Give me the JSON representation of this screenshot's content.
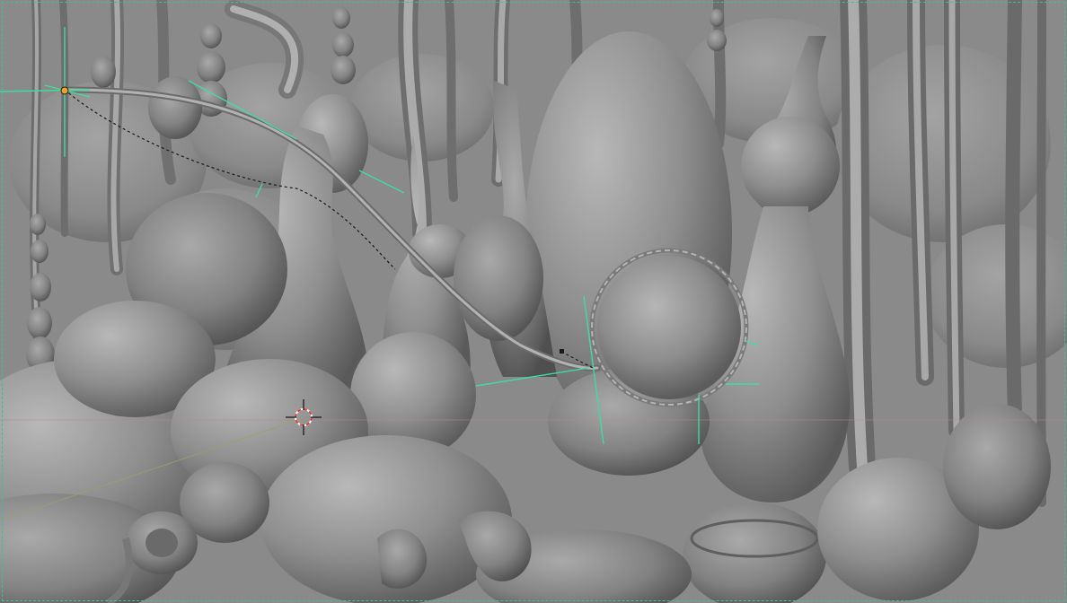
{
  "viewport": {
    "background": "#8a8a8a",
    "frame_color": "#3fbf96",
    "gizmo_color": "#3fdca0",
    "curve_color": "#1a1a1a",
    "cursor_color": "#d94040",
    "selected_point_color": "#f0a030",
    "horizon_color": "#9aa06a"
  },
  "scene": {
    "mode": "3D viewport",
    "shading": "solid",
    "objects": [
      "organic-sculpt",
      "hanging-tendrils",
      "sphere",
      "curve-path"
    ]
  }
}
